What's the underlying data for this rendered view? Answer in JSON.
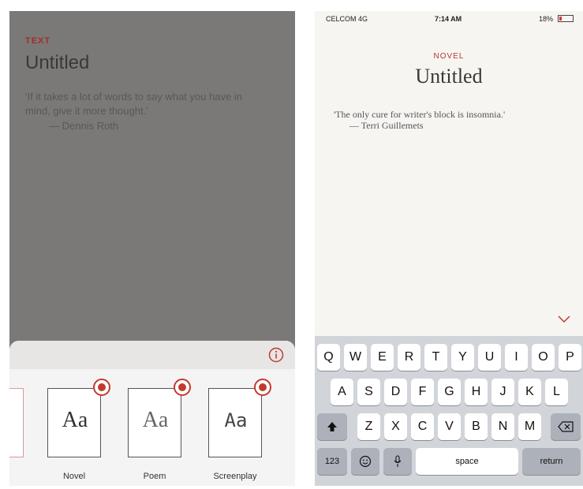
{
  "left": {
    "category": "TEXT",
    "title": "Untitled",
    "quote": "'If it takes a lot of words to say what you have in mind, give it more thought.'",
    "author": "— Dennis Roth",
    "templates": [
      {
        "label": "Novel",
        "glyph": "Aa"
      },
      {
        "label": "Poem",
        "glyph": "Aa"
      },
      {
        "label": "Screenplay",
        "glyph": "Aa"
      }
    ],
    "info_icon": "info-circle-icon"
  },
  "right": {
    "status": {
      "carrier": "CELCOM 4G",
      "time": "7:14 AM",
      "battery": "18%"
    },
    "category": "NOVEL",
    "title": "Untitled",
    "quote": "'The only cure for writer's block is insomnia.'",
    "author": "— Terri Guillemets",
    "chevron_icon": "chevron-down-icon",
    "keyboard": {
      "row1": [
        "Q",
        "W",
        "E",
        "R",
        "T",
        "Y",
        "U",
        "I",
        "O",
        "P"
      ],
      "row2": [
        "A",
        "S",
        "D",
        "F",
        "G",
        "H",
        "J",
        "K",
        "L"
      ],
      "row3": [
        "Z",
        "X",
        "C",
        "V",
        "B",
        "N",
        "M"
      ],
      "bottom": {
        "numbers": "123",
        "space": "space",
        "return": "return"
      }
    }
  },
  "colors": {
    "accent": "#c23a2f"
  }
}
